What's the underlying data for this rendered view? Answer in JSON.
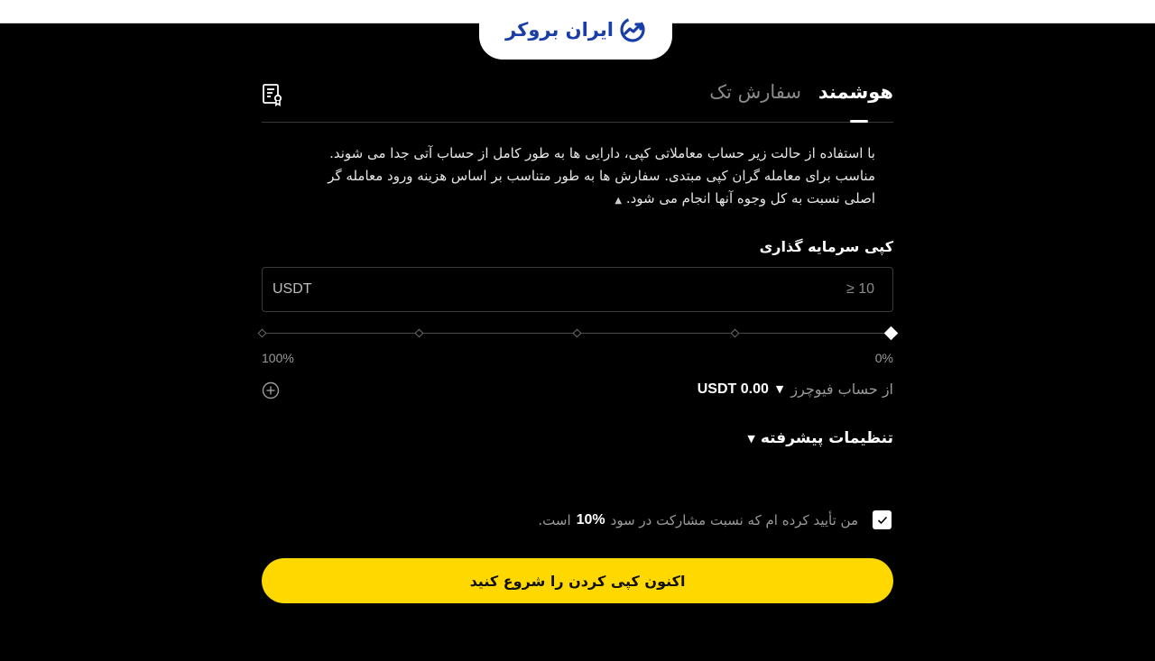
{
  "header": {
    "logo_text": "ایران بروکر",
    "brand_color": "#1a3ea8"
  },
  "tabs": [
    {
      "label": "هوشمند",
      "active": true
    },
    {
      "label": "سفارش تک",
      "active": false
    }
  ],
  "description": {
    "line1": "با استفاده از حالت زیر حساب معاملاتی کپی، دارایی ها به طور کامل از حساب آتی جدا می شوند.",
    "line2": "مناسب برای معامله گران کپی مبتدی. سفارش ها به طور متناسب بر اساس هزینه ورود معامله گر",
    "line3": "اصلی نسبت به کل وجوه آنها انجام می شود."
  },
  "investment": {
    "label": "کپی سرمایه گذاری",
    "currency": "USDT",
    "placeholder": "≥ 10"
  },
  "slider": {
    "value_percent": 0,
    "label_min": "0%",
    "label_max": "100%"
  },
  "balance": {
    "from_label": "از حساب فیوچرز",
    "value": "0.00 USDT"
  },
  "advanced": {
    "label": "تنظیمات پیشرفته"
  },
  "confirm": {
    "text_before": "من تأیید کرده ام که نسبت مشارکت در سود",
    "percent": "10%",
    "text_after": "است.",
    "checked": true
  },
  "cta": {
    "label": "اکنون کپی کردن را شروع کنید",
    "color": "#ffd800"
  }
}
